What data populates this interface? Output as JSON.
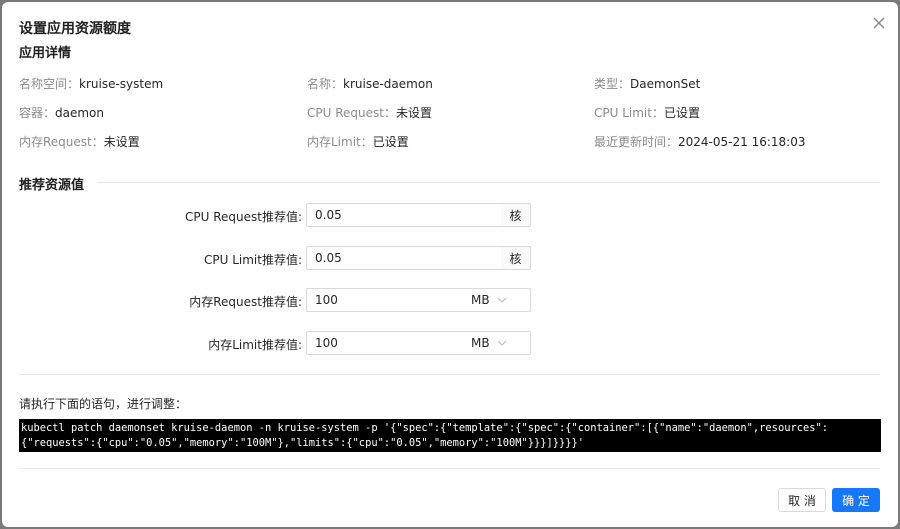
{
  "dialog": {
    "title": "设置应用资源额度",
    "cancel_label": "取 消",
    "ok_label": "确 定"
  },
  "details": {
    "section_title": "应用详情",
    "namespace_label": "名称空间：",
    "namespace_value": "kruise-system",
    "name_label": "名称：",
    "name_value": "kruise-daemon",
    "type_label": "类型：",
    "type_value": "DaemonSet",
    "container_label": "容器：",
    "container_value": "daemon",
    "cpu_request_label": "CPU Request：",
    "cpu_request_value": "未设置",
    "cpu_limit_label": "CPU Limit：",
    "cpu_limit_value": "已设置",
    "mem_request_label": "内存Request：",
    "mem_request_value": "未设置",
    "mem_limit_label": "内存Limit：",
    "mem_limit_value": "已设置",
    "updated_label": "最近更新时间：",
    "updated_value": "2024-05-21 16:18:03"
  },
  "recommend": {
    "section_title": "推荐资源值",
    "cpu_request_label": "CPU Request推荐值:",
    "cpu_request_value": "0.05",
    "cpu_request_unit": "核",
    "cpu_limit_label": "CPU Limit推荐值:",
    "cpu_limit_value": "0.05",
    "cpu_limit_unit": "核",
    "mem_request_label": "内存Request推荐值:",
    "mem_request_value": "100",
    "mem_request_unit": "MB",
    "mem_limit_label": "内存Limit推荐值:",
    "mem_limit_value": "100",
    "mem_limit_unit": "MB"
  },
  "command": {
    "hint": "请执行下面的语句，进行调整：",
    "line1": "kubectl patch daemonset kruise-daemon -n kruise-system -p '{\"spec\":{\"template\":{\"spec\":{\"container\":[{\"name\":\"daemon\",resources\":",
    "line2": "{\"requests\":{\"cpu\":\"0.05\",\"memory\":\"100M\"},\"limits\":{\"cpu\":\"0.05\",\"memory\":\"100M\"}}}]}}}}'"
  }
}
